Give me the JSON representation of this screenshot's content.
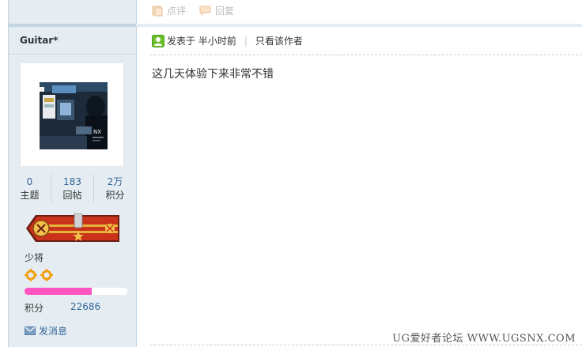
{
  "top_actions": {
    "rate_label": "点评",
    "reply_label": "回复"
  },
  "author": {
    "name": "Guitar*",
    "avatar_alt": "NX",
    "stats": [
      {
        "value": "0",
        "label": "主题"
      },
      {
        "value": "183",
        "label": "回帖"
      },
      {
        "value": "2万",
        "label": "积分"
      }
    ],
    "rank": "少将",
    "progress": 0.65,
    "credit_label": "积分",
    "credit_value": "22686",
    "message_label": "发消息"
  },
  "post": {
    "posted_label": "发表于 半小时前",
    "only_author_label": "只看该作者",
    "content": "这几天体验下来非常不错"
  },
  "watermark": "UG爱好者论坛 WWW.UGSNX.COM",
  "colors": {
    "sidebar_bg": "#e5edf2",
    "border": "#c2d5e3",
    "link": "#336699",
    "progress": "#ff55c0"
  }
}
